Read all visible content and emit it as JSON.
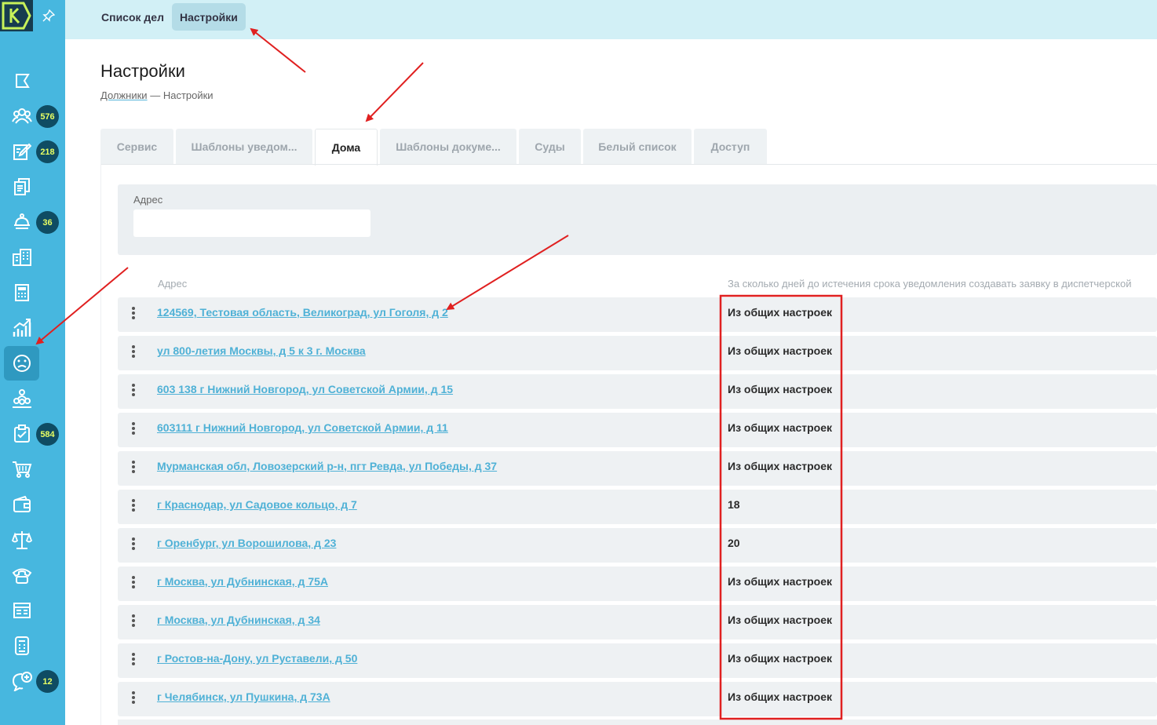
{
  "app": {
    "logo_letter": "К"
  },
  "colors": {
    "sidebar": "#47b7df",
    "accent": "#4fb1d6",
    "badge_text": "#e8ff63",
    "annotation": "#e02020"
  },
  "sidebar": {
    "items": [
      {
        "icon": "flag-icon",
        "badge": ""
      },
      {
        "icon": "users-group-icon",
        "badge": "576"
      },
      {
        "icon": "edit-document-icon",
        "badge": "218"
      },
      {
        "icon": "documents-icon",
        "badge": ""
      },
      {
        "icon": "bell-icon",
        "badge": "36"
      },
      {
        "icon": "building-icon",
        "badge": ""
      },
      {
        "icon": "calculator-icon",
        "badge": ""
      },
      {
        "icon": "chart-growth-icon",
        "badge": ""
      },
      {
        "icon": "sad-face-icon",
        "badge": "",
        "active": true
      },
      {
        "icon": "team-icon",
        "badge": ""
      },
      {
        "icon": "checklist-icon",
        "badge": "584"
      },
      {
        "icon": "cart-icon",
        "badge": ""
      },
      {
        "icon": "wallet-icon",
        "badge": ""
      },
      {
        "icon": "scales-icon",
        "badge": ""
      },
      {
        "icon": "phone-icon",
        "badge": ""
      },
      {
        "icon": "newspaper-icon",
        "badge": ""
      },
      {
        "icon": "mobile-calculator-icon",
        "badge": ""
      },
      {
        "icon": "chat-add-icon",
        "badge": "12"
      }
    ]
  },
  "top_tabs": [
    {
      "label": "Список дел"
    },
    {
      "label": "Настройки",
      "active": true
    }
  ],
  "page": {
    "title": "Настройки",
    "breadcrumb": {
      "parent": "Должники",
      "separator": "—",
      "current": "Настройки"
    }
  },
  "tabs": [
    {
      "label": "Сервис"
    },
    {
      "label": "Шаблоны уведом..."
    },
    {
      "label": "Дома",
      "active": true
    },
    {
      "label": "Шаблоны докуме..."
    },
    {
      "label": "Суды"
    },
    {
      "label": "Белый список"
    },
    {
      "label": "Доступ"
    }
  ],
  "filter": {
    "label": "Адрес",
    "value": "",
    "placeholder": ""
  },
  "table": {
    "headers": {
      "address": "Адрес",
      "days": "За сколько дней до истечения срока уведомления создавать заявку в диспетчерской"
    },
    "rows": [
      {
        "address": "124569, Тестовая область, Великоград, ул Гоголя, д 2",
        "days": "Из общих настроек"
      },
      {
        "address": "ул 800-летия Москвы, д 5 к 3 г. Москва",
        "days": "Из общих настроек"
      },
      {
        "address": "603 138 г Нижний Новгород, ул Советской Армии, д 15",
        "days": "Из общих настроек"
      },
      {
        "address": "603111 г Нижний Новгород, ул Советской Армии, д 11",
        "days": "Из общих настроек"
      },
      {
        "address": "Мурманская обл, Ловозерский р-н, пгт Ревда, ул Победы, д 37",
        "days": "Из общих настроек"
      },
      {
        "address": "г Краснодар, ул Садовое кольцо, д 7",
        "days": "18"
      },
      {
        "address": "г Оренбург, ул Ворошилова, д 23",
        "days": "20"
      },
      {
        "address": "г Москва, ул Дубнинская, д 75А",
        "days": "Из общих настроек"
      },
      {
        "address": "г Москва, ул Дубнинская, д 34",
        "days": "Из общих настроек"
      },
      {
        "address": "г Ростов-на-Дону, ул Руставели, д 50",
        "days": "Из общих настроек"
      },
      {
        "address": "г Челябинск, ул Пушкина, д 73А",
        "days": "Из общих настроек"
      }
    ]
  }
}
